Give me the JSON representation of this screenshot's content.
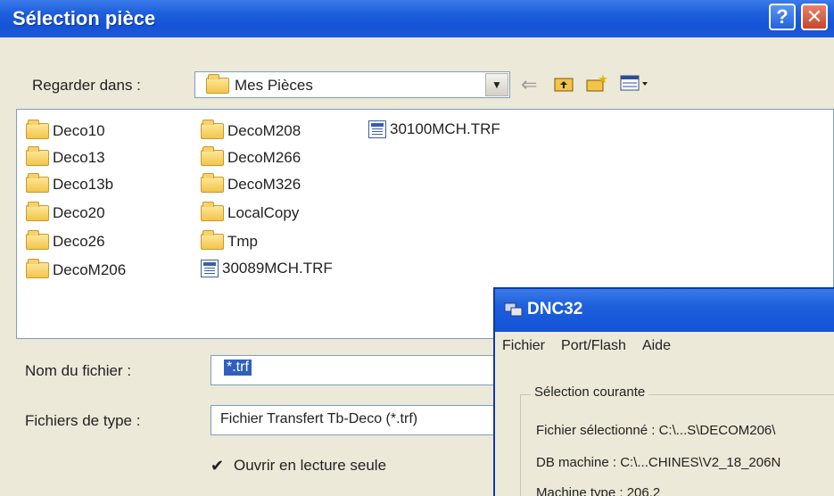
{
  "dialog": {
    "title": "Sélection pièce",
    "help_label": "?",
    "close_label": "✕",
    "look_in_label": "Regarder dans :",
    "look_in_value": "Mes Pièces",
    "tools": [
      "back-arrow",
      "up-folder",
      "new-folder",
      "view-menu"
    ],
    "items": [
      {
        "name": "Deco10",
        "type": "folder"
      },
      {
        "name": "Deco13",
        "type": "folder"
      },
      {
        "name": "Deco13b",
        "type": "folder"
      },
      {
        "name": "Deco20",
        "type": "folder"
      },
      {
        "name": "Deco26",
        "type": "folder"
      },
      {
        "name": "DecoM206",
        "type": "folder"
      },
      {
        "name": "DecoM208",
        "type": "folder"
      },
      {
        "name": "DecoM266",
        "type": "folder"
      },
      {
        "name": "DecoM326",
        "type": "folder"
      },
      {
        "name": "LocalCopy",
        "type": "folder"
      },
      {
        "name": "Tmp",
        "type": "folder"
      },
      {
        "name": "30089MCH.TRF",
        "type": "file"
      },
      {
        "name": "30100MCH.TRF",
        "type": "file"
      }
    ],
    "filename_label": "Nom du fichier :",
    "filename_value": "*.trf",
    "filetype_label": "Fichiers de type :",
    "filetype_value": "Fichier Transfert Tb-Deco (*.trf)",
    "readonly_label": "Ouvrir en lecture seule",
    "readonly_checked": "✔"
  },
  "dnc": {
    "title": "DNC32",
    "menu": [
      "Fichier",
      "Port/Flash",
      "Aide"
    ],
    "group_label": "Sélection courante",
    "lines": [
      "Fichier sélectionné : C:\\...S\\DECOM206\\",
      "DB machine : C:\\...CHINES\\V2_18_206N",
      "Machine type : 206.2"
    ]
  }
}
